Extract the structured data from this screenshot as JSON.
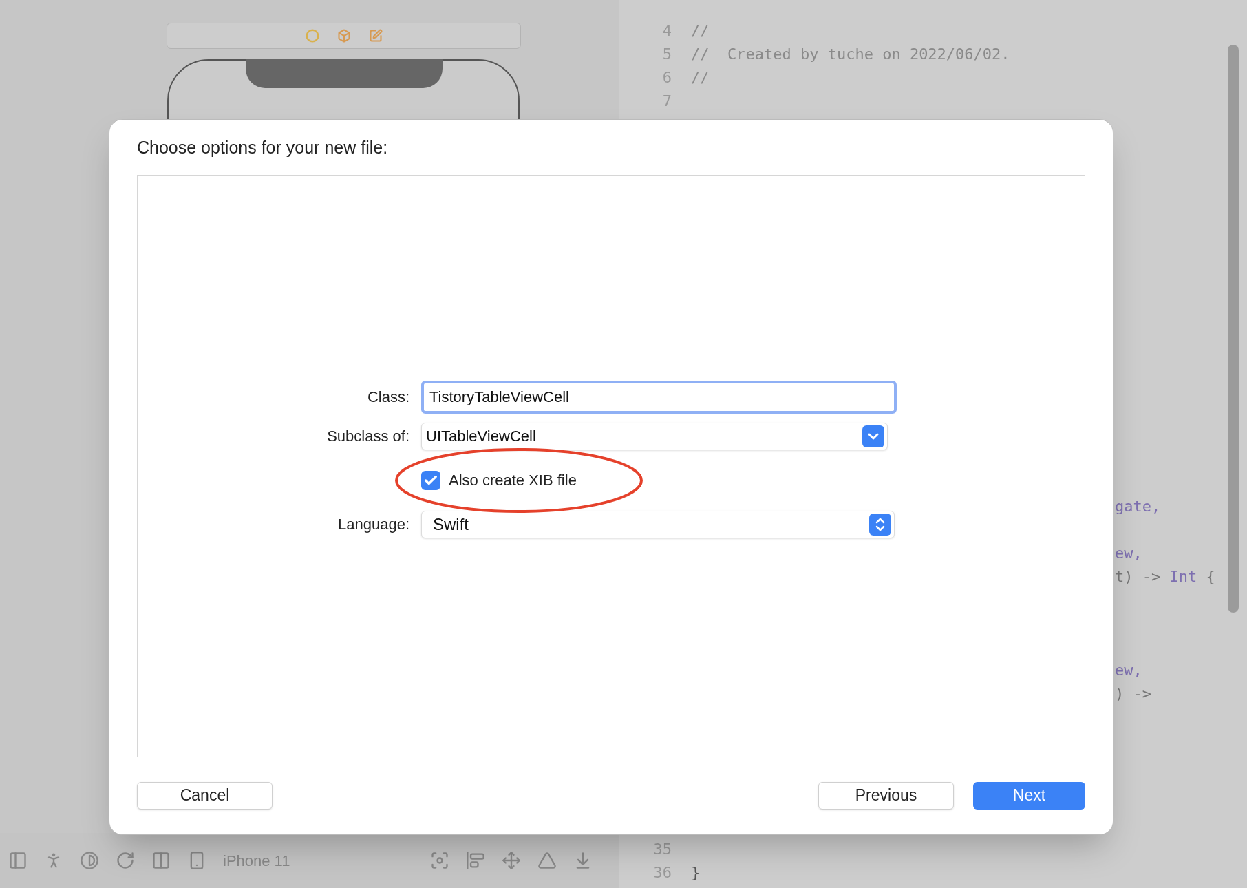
{
  "canvas": {
    "device_label": "iPhone 11"
  },
  "editor": {
    "top_lines": [
      {
        "number": "4",
        "code": "//"
      },
      {
        "number": "5",
        "code": "//  Created by tuche on 2022/06/02."
      },
      {
        "number": "6",
        "code": "//"
      },
      {
        "number": "7"
      }
    ],
    "fragments": [
      [
        {
          "text": "gate,",
          "kind": "identifier"
        }
      ],
      [
        {
          "text": "ew,",
          "kind": "identifier"
        }
      ],
      [
        {
          "text": "t) -> ",
          "kind": "plain"
        },
        {
          "text": "Int",
          "kind": "identifier"
        },
        {
          "text": " {",
          "kind": "plain"
        }
      ],
      [
        {
          "text": "ew,",
          "kind": "identifier"
        }
      ],
      [
        {
          "text": ") ->",
          "kind": "plain"
        }
      ]
    ],
    "bottom_lines": [
      {
        "number": "35"
      },
      {
        "number": "36",
        "code": "}"
      }
    ]
  },
  "dialog": {
    "title": "Choose options for your new file:",
    "rows": [
      {
        "kind": "text",
        "label": "Class:",
        "value": "TistoryTableViewCell",
        "focused": true
      },
      {
        "kind": "pulldown",
        "label": "Subclass of:",
        "value": "UITableViewCell"
      },
      {
        "kind": "checkbox",
        "label": "Also create XIB file",
        "checked": true,
        "highlighted": true
      },
      {
        "kind": "popup",
        "label": "Language:",
        "value": "Swift"
      }
    ],
    "left_buttons": [
      {
        "label": "Cancel",
        "default": false
      }
    ],
    "right_buttons": [
      {
        "label": "Previous",
        "default": false
      },
      {
        "label": "Next",
        "default": true
      }
    ]
  }
}
